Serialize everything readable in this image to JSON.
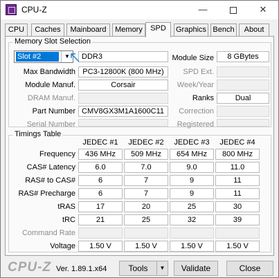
{
  "window": {
    "title": "CPU-Z",
    "min": "—",
    "close": "✕"
  },
  "tabs": [
    "CPU",
    "Caches",
    "Mainboard",
    "Memory",
    "SPD",
    "Graphics",
    "Bench",
    "About"
  ],
  "slot": {
    "group_title": "Memory Slot Selection",
    "selected": "Slot #2",
    "type": "DDR3",
    "labels": {
      "max_bandwidth": "Max Bandwidth",
      "module_manuf": "Module Manuf.",
      "dram_manuf": "DRAM Manuf.",
      "part_number": "Part Number",
      "serial_number": "Serial Number",
      "module_size": "Module Size",
      "spd_ext": "SPD Ext.",
      "week_year": "Week/Year",
      "ranks": "Ranks",
      "correction": "Correction",
      "registered": "Registered"
    },
    "values": {
      "max_bandwidth": "PC3-12800K (800 MHz)",
      "module_manuf": "Corsair",
      "dram_manuf": "",
      "part_number": "CMV8GX3M1A1600C11",
      "serial_number": "",
      "module_size": "8 GBytes",
      "spd_ext": "",
      "week_year": "",
      "ranks": "Dual",
      "correction": "",
      "registered": ""
    }
  },
  "timings": {
    "group_title": "Timings Table",
    "columns": [
      "JEDEC #1",
      "JEDEC #2",
      "JEDEC #3",
      "JEDEC #4"
    ],
    "rows": [
      {
        "label": "Frequency",
        "values": [
          "436 MHz",
          "509 MHz",
          "654 MHz",
          "800 MHz"
        ]
      },
      {
        "label": "CAS# Latency",
        "values": [
          "6.0",
          "7.0",
          "9.0",
          "11.0"
        ]
      },
      {
        "label": "RAS# to CAS#",
        "values": [
          "6",
          "7",
          "9",
          "11"
        ]
      },
      {
        "label": "RAS# Precharge",
        "values": [
          "6",
          "7",
          "9",
          "11"
        ]
      },
      {
        "label": "tRAS",
        "values": [
          "17",
          "20",
          "25",
          "30"
        ]
      },
      {
        "label": "tRC",
        "values": [
          "21",
          "25",
          "32",
          "39"
        ]
      },
      {
        "label": "Command Rate",
        "values": [
          "",
          "",
          "",
          ""
        ]
      },
      {
        "label": "Voltage",
        "values": [
          "1.50 V",
          "1.50 V",
          "1.50 V",
          "1.50 V"
        ]
      }
    ]
  },
  "footer": {
    "logo": "CPU-Z",
    "version": "Ver. 1.89.1.x64",
    "tools": "Tools",
    "validate": "Validate",
    "close": "Close"
  }
}
